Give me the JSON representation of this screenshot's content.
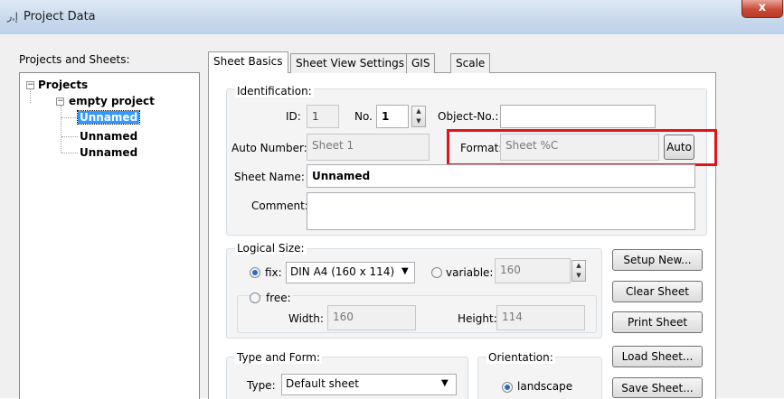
{
  "window": {
    "title": "Project Data",
    "close_label": "x"
  },
  "left": {
    "label": "Projects and Sheets:",
    "tree": {
      "root": "Projects",
      "project": "empty project",
      "sheets": [
        "Unnamed",
        "Unnamed",
        "Unnamed"
      ]
    }
  },
  "tabs": [
    "Sheet Basics",
    "Sheet View Settings",
    "GIS",
    "Scale"
  ],
  "identification": {
    "group_label": "Identification:",
    "id_label": "ID:",
    "id_value": "1",
    "no_label": "No.",
    "no_value": "1",
    "object_no_label": "Object-No.:",
    "object_no_value": "",
    "auto_number_label": "Auto Number:",
    "auto_number_value": "Sheet 1",
    "format_label": "Format:",
    "format_value": "Sheet %C",
    "auto_button": "Auto",
    "sheet_name_label": "Sheet Name:",
    "sheet_name_value": "Unnamed",
    "comment_label": "Comment:",
    "comment_value": ""
  },
  "logical_size": {
    "group_label": "Logical Size:",
    "fix_label": "fix:",
    "fix_value": "DIN A4 (160 x 114)",
    "variable_label": "variable:",
    "variable_value": "160",
    "free_label": "free:",
    "width_label": "Width:",
    "width_value": "160",
    "height_label": "Height:",
    "height_value": "114"
  },
  "type_form": {
    "group_label": "Type and Form:",
    "type_label": "Type:",
    "type_value": "Default sheet"
  },
  "orientation": {
    "group_label": "Orientation:",
    "landscape_label": "landscape"
  },
  "buttons": {
    "setup_new": "Setup New...",
    "clear_sheet": "Clear Sheet",
    "print_sheet": "Print Sheet",
    "load_sheet": "Load Sheet...",
    "save_sheet": "Save Sheet..."
  },
  "colors": {
    "highlight": "#e4121b",
    "selection": "#3399ff"
  }
}
